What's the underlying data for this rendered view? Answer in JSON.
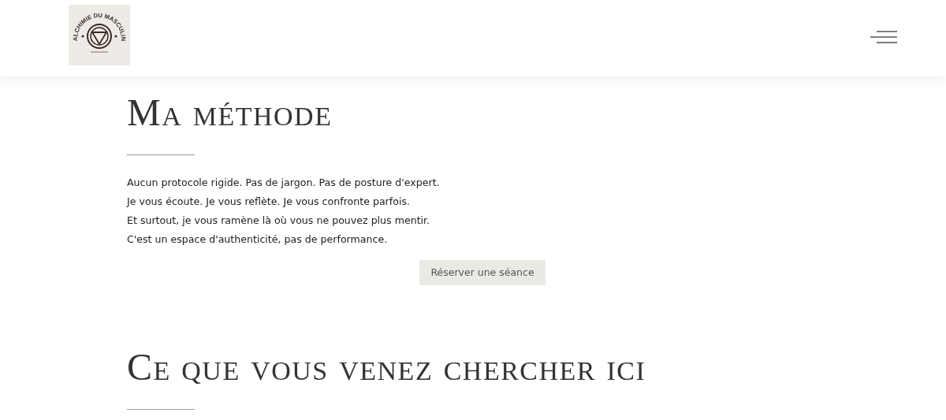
{
  "header": {
    "logo_text": "ALCHIMIE DU MASCULIN"
  },
  "sections": [
    {
      "title": "Ma méthode",
      "paragraph_lines": [
        "Aucun protocole rigide. Pas de jargon. Pas de posture d'expert.",
        "Je vous écoute. Je vous reflète. Je vous confronte parfois.",
        "Et surtout, je vous ramène là où vous ne pouvez plus mentir.",
        "C'est un espace d'authenticité, pas de performance."
      ],
      "button": "Réserver une séance"
    },
    {
      "title": "Ce que vous venez chercher ici"
    }
  ]
}
